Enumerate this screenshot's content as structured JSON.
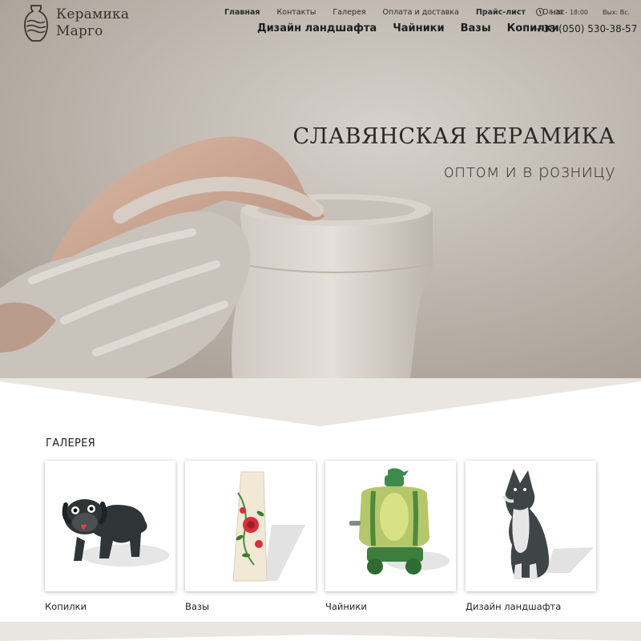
{
  "brand": {
    "line1": "Керамика",
    "line2": "Марго"
  },
  "topnav": [
    {
      "label": "Главная",
      "bold": true
    },
    {
      "label": "Контакты",
      "bold": false
    },
    {
      "label": "Галерея",
      "bold": false
    },
    {
      "label": "Оплата и доставка",
      "bold": false
    },
    {
      "label": "Прайс-лист",
      "bold": true
    },
    {
      "label": "О нас",
      "bold": false
    }
  ],
  "mainnav": [
    "Дизайн ландшафта",
    "Чайники",
    "Вазы",
    "Копилки"
  ],
  "contact": {
    "hours": "8:30 - 18:00",
    "days_off": "Вых: Вс.",
    "phone": "+38 (050) 530-38-57"
  },
  "hero": {
    "title": "СЛАВЯНСКАЯ КЕРАМИКА",
    "subtitle": "оптом и в розницу"
  },
  "gallery": {
    "title": "ГАЛЕРЕЯ",
    "items": [
      {
        "label": "Копилки",
        "image": "ceramic-dog-piggy-bank"
      },
      {
        "label": "Вазы",
        "image": "painted-floral-vase"
      },
      {
        "label": "Чайники",
        "image": "barrel-wine-dispenser"
      },
      {
        "label": "Дизайн ландшафта",
        "image": "ceramic-wolf-figurine"
      }
    ]
  },
  "colors": {
    "hero_bg": "#c4bdb5",
    "accent_band": "#e8e4e0",
    "text_dark": "#2e2824"
  }
}
